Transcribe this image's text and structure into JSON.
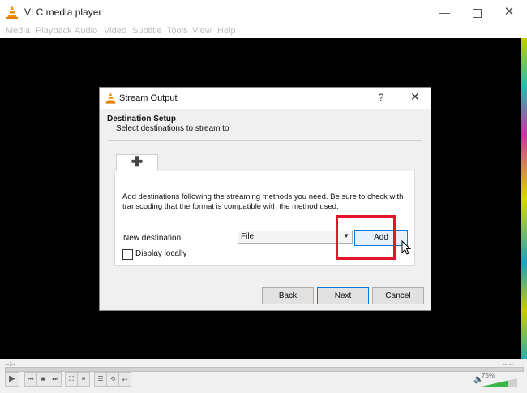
{
  "window": {
    "title": "VLC media player",
    "min_icon": "—",
    "close_icon": "✕"
  },
  "menu": {
    "items": [
      "Media",
      "Playback",
      "Audio",
      "Video",
      "Subtitle",
      "Tools",
      "View",
      "Help"
    ]
  },
  "dialog": {
    "title": "Stream Output",
    "help": "?",
    "close": "✕",
    "header_title": "Destination Setup",
    "header_subtitle": "Select destinations to stream to",
    "tab_add_glyph": "✚",
    "description": "Add destinations following the streaming methods you need. Be sure to check with transcoding that the format is compatible with the method used.",
    "new_destination_label": "New destination",
    "destination_value": "File",
    "destination_arrow": "▼",
    "add_button": "Add",
    "display_locally": "Display locally",
    "display_locally_checked": false,
    "back_button": "Back",
    "next_button": "Next",
    "cancel_button": "Cancel",
    "highlight_color": "#e2172a"
  },
  "controls": {
    "time_elapsed": "--:--",
    "time_total": "--:--",
    "play_glyph": "▶",
    "prev_glyph": "⏮",
    "stop_glyph": "■",
    "next_glyph": "⏭",
    "fullscreen_glyph": "⛶",
    "extended_glyph": "≡",
    "playlist_glyph": "☰",
    "loop_glyph": "⟲",
    "random_glyph": "⇄",
    "volume_icon": "🔈",
    "volume_percent": "75%",
    "volume_level": 0.75
  }
}
